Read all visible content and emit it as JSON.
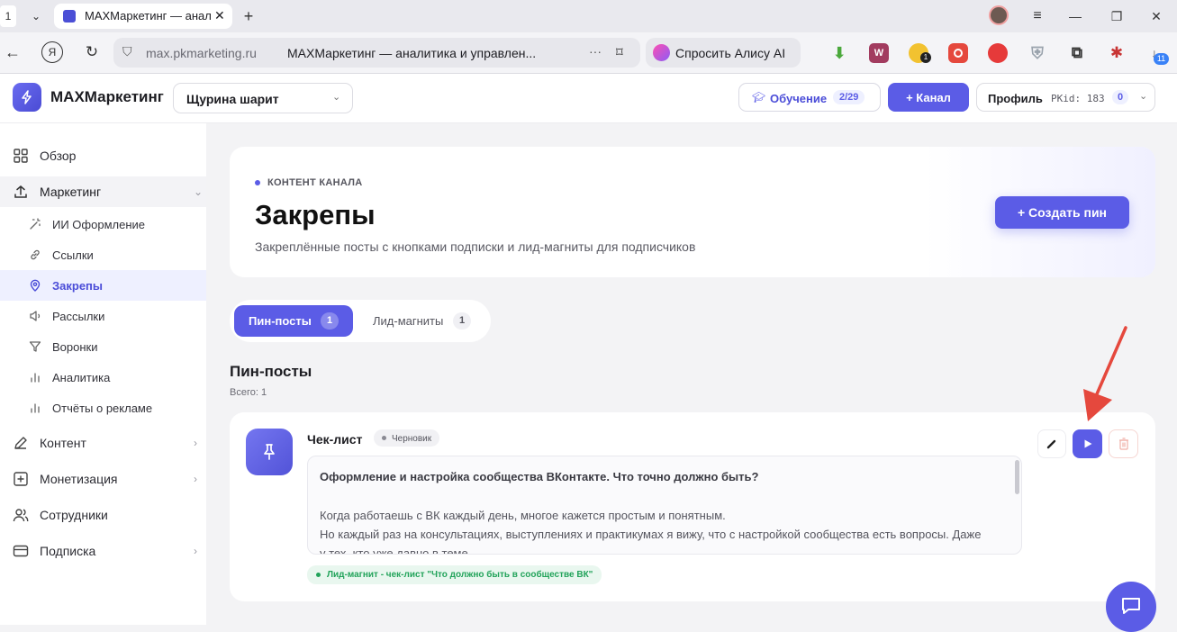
{
  "browser": {
    "tab_number": "1",
    "tab_title": "MAXМаркетинг — анал",
    "url_host": "max.pkmarketing.ru",
    "page_title": "MAXМаркетинг — аналитика и управлен...",
    "alice_label": "Спросить Алису AI",
    "ext_badge_1": "1",
    "ext_badge_11": "11"
  },
  "header": {
    "brand": "MAXМаркетинг",
    "channel_select": "Щурина шарит",
    "learning_label": "Обучение",
    "learning_progress": "2/29",
    "add_channel_label": "+ Канал",
    "profile_label": "Профиль",
    "pkid_label": "PKid: 183",
    "pkid_badge": "0"
  },
  "sidebar": {
    "overview": "Обзор",
    "marketing": "Маркетинг",
    "marketing_items": [
      "ИИ Оформление",
      "Ссылки",
      "Закрепы",
      "Рассылки",
      "Воронки",
      "Аналитика",
      "Отчёты о рекламе"
    ],
    "content": "Контент",
    "monetization": "Монетизация",
    "staff": "Сотрудники",
    "subscription": "Подписка"
  },
  "hero": {
    "eyebrow": "КОНТЕНТ КАНАЛА",
    "title": "Закрепы",
    "subtitle": "Закреплённые посты с кнопками подписки и лид-магниты для подписчиков",
    "create_button": "+ Создать пин"
  },
  "tabs": [
    {
      "label": "Пин-посты",
      "count": "1"
    },
    {
      "label": "Лид-магниты",
      "count": "1"
    }
  ],
  "section": {
    "title": "Пин-посты",
    "total": "Всего: 1"
  },
  "pin": {
    "name": "Чек-лист",
    "status": "Черновик",
    "post_title": "Оформление и настройка сообщества ВКонтакте. Что точно должно быть?",
    "post_line1": "Когда работаешь с ВК каждый день, многое кажется простым и понятным.",
    "post_line2": "Но каждый раз на консультациях, выступлениях и практикумах я вижу, что с настройкой сообщества есть вопросы. Даже",
    "post_line3": "у тех, кто уже давно в теме.",
    "lead_tag": "Лид-магнит - чек-лист \"Что должно быть в сообществе ВК\""
  },
  "colors": {
    "accent": "#5b5ce6",
    "active_bg": "#eef0ff",
    "green": "#22a35a",
    "arrow": "#e5483d"
  }
}
